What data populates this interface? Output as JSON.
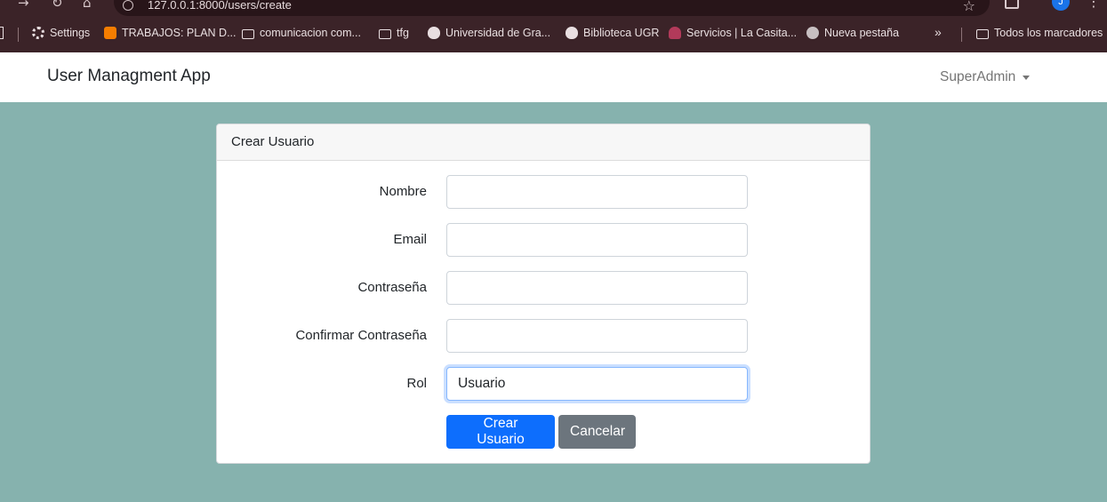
{
  "browser": {
    "url": "127.0.0.1:8000/users/create",
    "profile_initial": "J",
    "bookmarks": [
      {
        "label": "Settings",
        "icon": "gear-icon"
      },
      {
        "label": "TRABAJOS: PLAN D...",
        "icon": "blogger-icon"
      },
      {
        "label": "comunicacion com...",
        "icon": "folder-icon"
      },
      {
        "label": "tfg",
        "icon": "folder-icon"
      },
      {
        "label": "Universidad de Gra...",
        "icon": "ugr-shield-icon"
      },
      {
        "label": "Biblioteca UGR",
        "icon": "ugr-shield-icon"
      },
      {
        "label": "Servicios | La Casita...",
        "icon": "cloud-icon"
      },
      {
        "label": "Nueva pestaña",
        "icon": "globe-icon"
      },
      {
        "label": "Todos los marcadores",
        "icon": "folder-icon"
      }
    ]
  },
  "app": {
    "brand": "User Managment App",
    "user_menu": "SuperAdmin"
  },
  "card": {
    "title": "Crear Usuario",
    "fields": [
      {
        "label": "Nombre",
        "value": ""
      },
      {
        "label": "Email",
        "value": ""
      },
      {
        "label": "Contraseña",
        "value": ""
      },
      {
        "label": "Confirmar Contraseña",
        "value": ""
      },
      {
        "label": "Rol",
        "value": "Usuario"
      }
    ],
    "submit_label": "Crear Usuario",
    "cancel_label": "Cancelar"
  },
  "colors": {
    "page_background": "#86b2ae",
    "chrome": "#3b2328",
    "primary": "#0d6efd",
    "secondary": "#6c757d"
  }
}
